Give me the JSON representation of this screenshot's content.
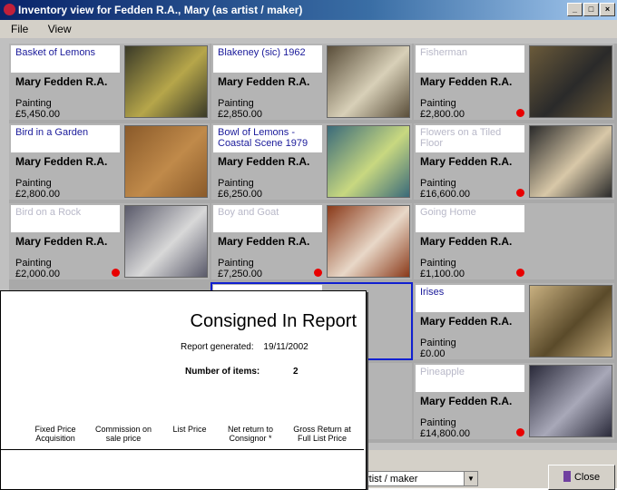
{
  "window": {
    "title": "Inventory view for Fedden R.A., Mary (as artist / maker)",
    "buttons": [
      "_",
      "□",
      "×"
    ]
  },
  "menu": [
    "File",
    "View"
  ],
  "tiles": [
    {
      "title": "Basket of Lemons",
      "artist": "Mary Fedden R.A.",
      "type": "Painting",
      "price": "£5,450.00",
      "dim": false,
      "dot": false,
      "pic": [
        "#3a3a28",
        "#b6a64a"
      ]
    },
    {
      "title": "Blakeney (sic) 1962",
      "artist": "Mary Fedden R.A.",
      "type": "Painting",
      "price": "£2,850.00",
      "dim": false,
      "dot": false,
      "pic": [
        "#5a4e3a",
        "#d8d0b8"
      ]
    },
    {
      "title": "Fisherman",
      "artist": "Mary Fedden R.A.",
      "type": "Painting",
      "price": "£2,800.00",
      "dim": true,
      "dot": true,
      "pic": [
        "#6a5a3a",
        "#2a2a2a"
      ]
    },
    {
      "title": "Bird in a Garden",
      "artist": "Mary Fedden R.A.",
      "type": "Painting",
      "price": "£2,800.00",
      "dim": false,
      "dot": false,
      "pic": [
        "#8a5a2a",
        "#c08a4a"
      ]
    },
    {
      "title": "Bowl of Lemons - Coastal Scene 1979",
      "artist": "Mary Fedden R.A.",
      "type": "Painting",
      "price": "£6,250.00",
      "dim": false,
      "dot": false,
      "pic": [
        "#3a6a7a",
        "#c8d880"
      ]
    },
    {
      "title": "Flowers on a Tiled Floor",
      "artist": "Mary Fedden R.A.",
      "type": "Painting",
      "price": "£16,600.00",
      "dim": true,
      "dot": true,
      "pic": [
        "#2a2a2a",
        "#d8c8a8"
      ]
    },
    {
      "title": "Bird on a Rock",
      "artist": "Mary Fedden R.A.",
      "type": "Painting",
      "price": "£2,000.00",
      "dim": true,
      "dot": true,
      "pic": [
        "#5a5a6a",
        "#d8d8d8"
      ]
    },
    {
      "title": "Boy and Goat",
      "artist": "Mary Fedden R.A.",
      "type": "Painting",
      "price": "£7,250.00",
      "dim": true,
      "dot": true,
      "pic": [
        "#8a3a1a",
        "#e8d8c8"
      ]
    },
    {
      "title": "Going Home",
      "artist": "Mary Fedden R.A.",
      "type": "Painting",
      "price": "£1,100.00",
      "dim": true,
      "dot": true,
      "pic": null
    },
    {
      "title": "",
      "artist": "",
      "type": "",
      "price": "",
      "dim": false,
      "dot": true,
      "pic": null
    },
    {
      "title": "Irises",
      "artist": "Mary Fedden R.A.",
      "type": "Painting",
      "price": "£0.00",
      "dim": false,
      "dot": false,
      "pic": [
        "#c8b080",
        "#5a4a2a"
      ]
    },
    {
      "title": "",
      "artist": "",
      "type": "",
      "price": "",
      "dim": false,
      "dot": false,
      "pic": null
    },
    {
      "title": "Pineapple",
      "artist": "Mary Fedden R.A.",
      "type": "Painting",
      "price": "£14,800.00",
      "dim": true,
      "dot": true,
      "pic": [
        "#2a2a3a",
        "#a8a8b8"
      ]
    }
  ],
  "report": {
    "title": "Consigned In Report",
    "generated_label": "Report generated:",
    "generated_value": "19/11/2002",
    "items_label": "Number of items:",
    "items_value": "2",
    "columns": [
      "Fixed Price\nAcquisition",
      "Commission on\nsale price",
      "List Price",
      "Net return to\nConsignor *",
      "Gross Return at\nFull List Price"
    ]
  },
  "combo_value": "rtist / maker",
  "close_label": "Close",
  "ellipsis": "•••"
}
